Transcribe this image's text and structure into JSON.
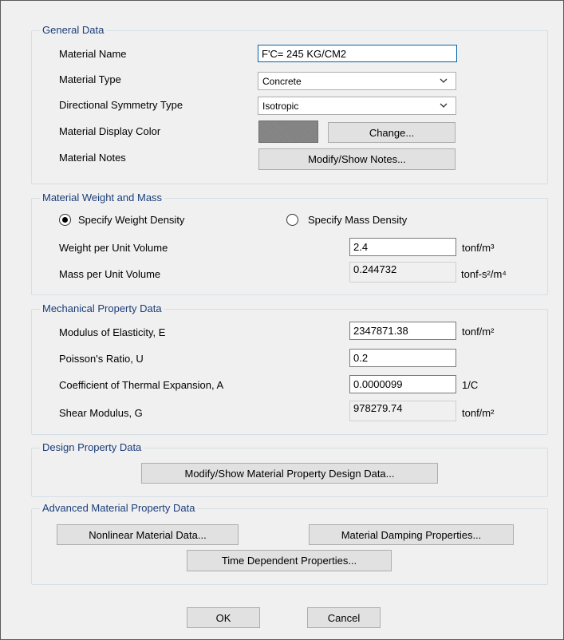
{
  "general": {
    "title": "General Data",
    "material_name_label": "Material Name",
    "material_name_value": "F'C= 245 KG/CM2",
    "material_type_label": "Material Type",
    "material_type_value": "Concrete",
    "symmetry_label": "Directional Symmetry Type",
    "symmetry_value": "Isotropic",
    "display_color_label": "Material Display Color",
    "display_color": "#858585",
    "change_button": "Change...",
    "notes_label": "Material Notes",
    "notes_button": "Modify/Show Notes..."
  },
  "weight": {
    "title": "Material Weight and Mass",
    "specify_weight_label": "Specify Weight Density",
    "specify_weight_selected": true,
    "specify_mass_label": "Specify Mass Density",
    "specify_mass_selected": false,
    "weight_label": "Weight per Unit Volume",
    "weight_value": "2.4",
    "weight_unit": "tonf/m³",
    "mass_label": "Mass per Unit Volume",
    "mass_value": "0.244732",
    "mass_unit": "tonf-s²/m⁴"
  },
  "mechanical": {
    "title": "Mechanical Property Data",
    "modulus_label": "Modulus of Elasticity,  E",
    "modulus_value": "2347871.38",
    "modulus_unit": "tonf/m²",
    "poisson_label": "Poisson's Ratio,  U",
    "poisson_value": "0.2",
    "thermal_label": "Coefficient of Thermal Expansion,  A",
    "thermal_value": "0.0000099",
    "thermal_unit": "1/C",
    "shear_label": "Shear Modulus,  G",
    "shear_value": "978279.74",
    "shear_unit": "tonf/m²"
  },
  "design": {
    "title": "Design Property Data",
    "button": "Modify/Show Material Property Design Data..."
  },
  "advanced": {
    "title": "Advanced Material Property Data",
    "nonlinear_button": "Nonlinear Material Data...",
    "damping_button": "Material Damping Properties...",
    "time_button": "Time Dependent Properties..."
  },
  "footer": {
    "ok": "OK",
    "cancel": "Cancel"
  }
}
